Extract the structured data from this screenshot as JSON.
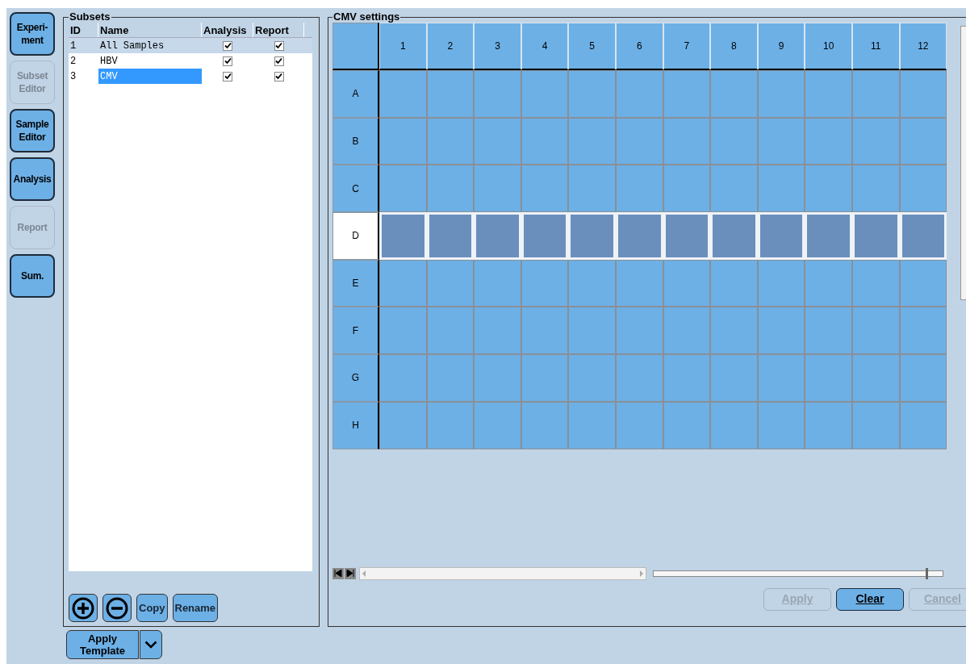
{
  "nav": [
    {
      "label": "Experi-\nment",
      "disabled": false
    },
    {
      "label": "Subset\nEditor",
      "disabled": true
    },
    {
      "label": "Sample\nEditor",
      "disabled": false
    },
    {
      "label": "Analysis",
      "disabled": false
    },
    {
      "label": "Report",
      "disabled": true
    },
    {
      "label": "Sum.",
      "disabled": false
    }
  ],
  "subsets": {
    "title": "Subsets",
    "columns": [
      "ID",
      "Name",
      "Analysis",
      "Report"
    ],
    "rows": [
      {
        "id": "1",
        "name": "All Samples",
        "analysis": true,
        "report": true,
        "selected": true,
        "editing": false
      },
      {
        "id": "2",
        "name": "HBV",
        "analysis": true,
        "report": true,
        "selected": false,
        "editing": false
      },
      {
        "id": "3",
        "name": "CMV",
        "analysis": true,
        "report": true,
        "selected": false,
        "editing": true
      }
    ],
    "buttons": [
      {
        "kind": "add"
      },
      {
        "kind": "remove"
      },
      {
        "kind": "text",
        "label": "Copy"
      },
      {
        "kind": "text",
        "label": "Rename"
      }
    ]
  },
  "apply_template": {
    "label": "Apply\nTemplate"
  },
  "plate": {
    "title": "CMV settings",
    "columns": [
      "1",
      "2",
      "3",
      "4",
      "5",
      "6",
      "7",
      "8",
      "9",
      "10",
      "11",
      "12"
    ],
    "rows": [
      {
        "label": "A",
        "selected": false
      },
      {
        "label": "B",
        "selected": false
      },
      {
        "label": "C",
        "selected": false
      },
      {
        "label": "D",
        "selected": true
      },
      {
        "label": "E",
        "selected": false
      },
      {
        "label": "F",
        "selected": false
      },
      {
        "label": "G",
        "selected": false
      },
      {
        "label": "H",
        "selected": false
      }
    ],
    "zoom": {
      "level": 0.94
    },
    "buttons": [
      {
        "label": "Apply",
        "disabled": true
      },
      {
        "label": "Clear",
        "disabled": false
      },
      {
        "label": "Cancel",
        "disabled": true
      }
    ]
  }
}
